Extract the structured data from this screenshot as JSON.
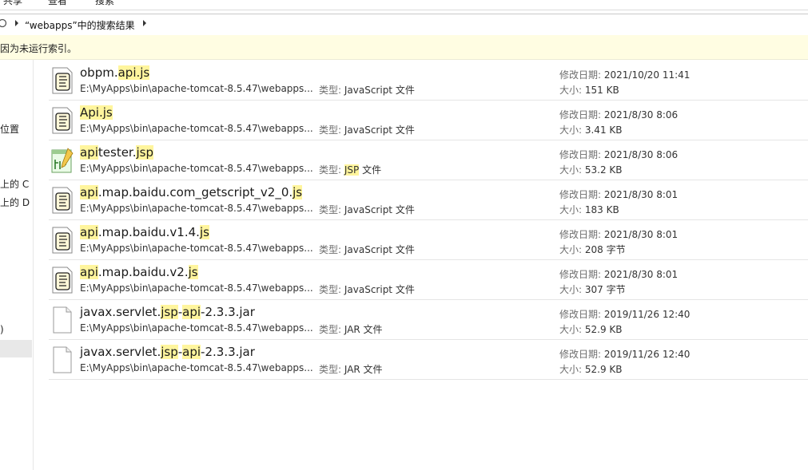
{
  "ribbon": {
    "tabs": [
      "共享",
      "查看",
      "搜索"
    ]
  },
  "address": {
    "path": "“webapps”中的搜索结果"
  },
  "info_bar": {
    "text": "因为未运行索引。"
  },
  "nav": {
    "items": [
      "位置",
      "上的 C",
      "上的 D",
      ")"
    ]
  },
  "labels": {
    "type": "类型:",
    "modified": "修改日期:",
    "size": "大小:"
  },
  "files": [
    {
      "name_parts": [
        {
          "t": "obpm."
        },
        {
          "t": "api.js",
          "h": true
        }
      ],
      "path": "E:\\MyApps\\bin\\apache-tomcat-8.5.47\\webapps...",
      "type_parts": [
        {
          "t": "JavaScript 文件"
        }
      ],
      "modified": "2021/10/20 11:41",
      "size": "151 KB",
      "icon": "js-script-icon"
    },
    {
      "name_parts": [
        {
          "t": "Api.js",
          "h": true
        }
      ],
      "path": "E:\\MyApps\\bin\\apache-tomcat-8.5.47\\webapps...",
      "type_parts": [
        {
          "t": "JavaScript 文件"
        }
      ],
      "modified": "2021/8/30 8:06",
      "size": "3.41 KB",
      "icon": "js-script-icon"
    },
    {
      "name_parts": [
        {
          "t": "api",
          "h": true
        },
        {
          "t": "tester."
        },
        {
          "t": "jsp",
          "h": true
        }
      ],
      "path": "E:\\MyApps\\bin\\apache-tomcat-8.5.47\\webapps...",
      "type_parts": [
        {
          "t": "JSP",
          "h": true
        },
        {
          "t": " 文件"
        }
      ],
      "modified": "2021/8/30 8:06",
      "size": "53.2 KB",
      "icon": "jsp-file-icon"
    },
    {
      "name_parts": [
        {
          "t": "api",
          "h": true
        },
        {
          "t": ".map.baidu.com_getscript_v2_0."
        },
        {
          "t": "js",
          "h": true
        }
      ],
      "path": "E:\\MyApps\\bin\\apache-tomcat-8.5.47\\webapps...",
      "type_parts": [
        {
          "t": "JavaScript 文件"
        }
      ],
      "modified": "2021/8/30 8:01",
      "size": "183 KB",
      "icon": "js-script-icon"
    },
    {
      "name_parts": [
        {
          "t": "api",
          "h": true
        },
        {
          "t": ".map.baidu.v1.4."
        },
        {
          "t": "js",
          "h": true
        }
      ],
      "path": "E:\\MyApps\\bin\\apache-tomcat-8.5.47\\webapps...",
      "type_parts": [
        {
          "t": "JavaScript 文件"
        }
      ],
      "modified": "2021/8/30 8:01",
      "size": "208 字节",
      "icon": "js-script-icon"
    },
    {
      "name_parts": [
        {
          "t": "api",
          "h": true
        },
        {
          "t": ".map.baidu.v2."
        },
        {
          "t": "js",
          "h": true
        }
      ],
      "path": "E:\\MyApps\\bin\\apache-tomcat-8.5.47\\webapps...",
      "type_parts": [
        {
          "t": "JavaScript 文件"
        }
      ],
      "modified": "2021/8/30 8:01",
      "size": "307 字节",
      "icon": "js-script-icon"
    },
    {
      "name_parts": [
        {
          "t": "javax.servlet."
        },
        {
          "t": "jsp",
          "h": true
        },
        {
          "t": "-"
        },
        {
          "t": "api",
          "h": true
        },
        {
          "t": "-2.3.3.jar"
        }
      ],
      "path": "E:\\MyApps\\bin\\apache-tomcat-8.5.47\\webapps...",
      "type_parts": [
        {
          "t": "JAR 文件"
        }
      ],
      "modified": "2019/11/26 12:40",
      "size": "52.9 KB",
      "icon": "blank-file-icon"
    },
    {
      "name_parts": [
        {
          "t": "javax.servlet."
        },
        {
          "t": "jsp",
          "h": true
        },
        {
          "t": "-"
        },
        {
          "t": "api",
          "h": true
        },
        {
          "t": "-2.3.3.jar"
        }
      ],
      "path": "E:\\MyApps\\bin\\apache-tomcat-8.5.47\\webapps...",
      "type_parts": [
        {
          "t": "JAR 文件"
        }
      ],
      "modified": "2019/11/26 12:40",
      "size": "52.9 KB",
      "icon": "blank-file-icon"
    }
  ]
}
